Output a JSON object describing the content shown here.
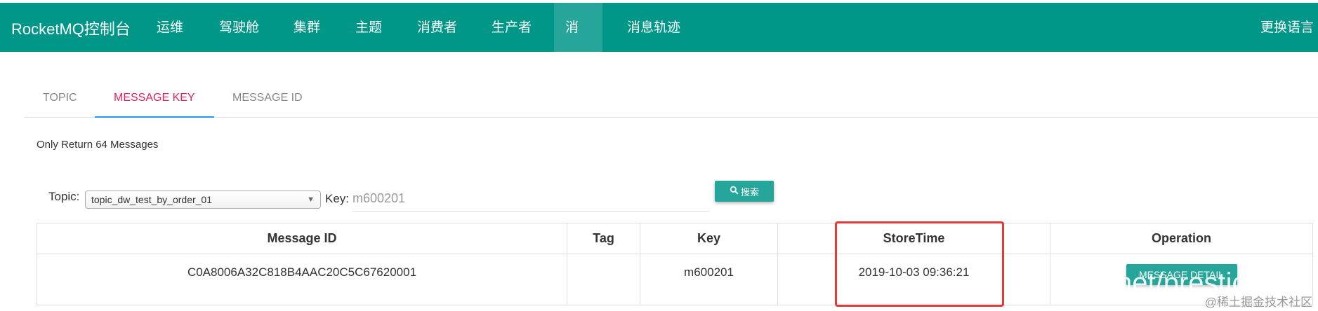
{
  "navbar": {
    "brand": "RocketMQ控制台",
    "items": [
      "运维",
      "驾驶舱",
      "集群",
      "主题",
      "消费者",
      "生产者",
      "消息",
      "消息轨迹"
    ],
    "active": "消息",
    "language": "更换语言"
  },
  "tabs": [
    {
      "label": "TOPIC",
      "active": false
    },
    {
      "label": "MESSAGE KEY",
      "active": true
    },
    {
      "label": "MESSAGE ID",
      "active": false
    }
  ],
  "info_text": "Only Return 64 Messages",
  "search": {
    "topic_label": "Topic:",
    "topic_value": "topic_dw_test_by_order_01",
    "key_label": "Key:",
    "key_value": "m600201",
    "button_label": "搜索"
  },
  "table": {
    "headers": [
      "Message ID",
      "Tag",
      "Key",
      "StoreTime",
      "Operation"
    ],
    "rows": [
      {
        "message_id": "C0A8006A32C818B4AAC20C5C67620001",
        "tag": "",
        "key": "m600201",
        "store_time": "2019-10-03 09:36:21",
        "operation": "MESSAGE DETAIL"
      }
    ]
  },
  "watermark": {
    "overlay": "net/prestic",
    "site": "@稀土掘金技术社区"
  },
  "colors": {
    "navbar": "#009688",
    "nav_active": "#26a69a",
    "button": "#26a69a",
    "tab_active_text": "#e91e63",
    "tab_active_underline": "#2196f3",
    "highlight": "#e53935"
  }
}
